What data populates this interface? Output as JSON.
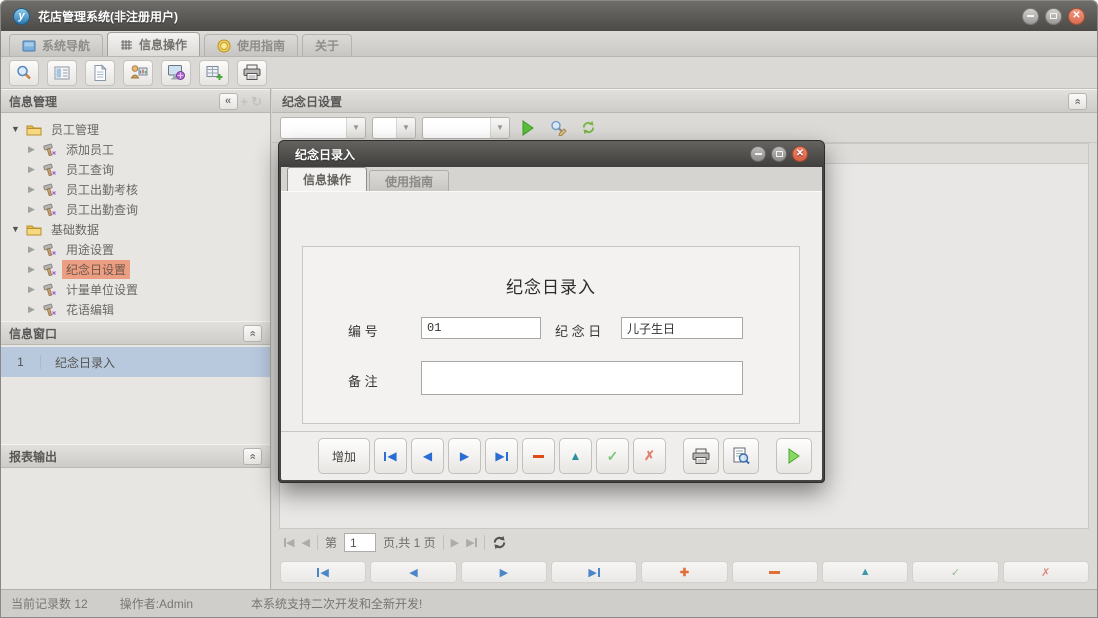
{
  "window": {
    "logo": "y",
    "title": "花店管理系统(非注册用户)"
  },
  "main_tabs": {
    "nav": "系统导航",
    "info": "信息操作",
    "guide": "使用指南",
    "about": "关于"
  },
  "sidebar": {
    "info_panel": {
      "title": "信息管理",
      "tree": [
        {
          "label": "员工管理"
        },
        {
          "label": "添加员工"
        },
        {
          "label": "员工查询"
        },
        {
          "label": "员工出勤考核"
        },
        {
          "label": "员工出勤查询"
        },
        {
          "label": "基础数据"
        },
        {
          "label": "用途设置"
        },
        {
          "label": "纪念日设置"
        },
        {
          "label": "计量单位设置"
        },
        {
          "label": "花语编辑"
        }
      ]
    },
    "window_panel": {
      "title": "信息窗口",
      "row_index": "1",
      "row_label": "纪念日录入"
    },
    "report_panel": {
      "title": "报表输出"
    }
  },
  "main": {
    "header_title": "纪念日设置",
    "pager": {
      "prefix": "第",
      "page": "1",
      "suffix": "页,共 1 页"
    }
  },
  "dialog": {
    "title": "纪念日录入",
    "tabs": {
      "info": "信息操作",
      "guide": "使用指南"
    },
    "form": {
      "title": "纪念日录入",
      "code_label": "编 号",
      "code_value": "01",
      "day_label": "纪 念 日",
      "day_value": "儿子生日",
      "note_label": "备 注",
      "note_value": ""
    },
    "add_label": "增加"
  },
  "statusbar": {
    "records": "当前记录数 12",
    "operator": "操作者:Admin",
    "message": "本系统支持二次开发和全新开发!"
  },
  "colors": {
    "tree_selected_bg": "#ec9e82",
    "list_selected_bg": "#b9c9dd",
    "accent_green": "#52b83a",
    "accent_blue": "#2b6cd4",
    "accent_orange": "#e0703a",
    "close_red": "#d96b4f"
  }
}
